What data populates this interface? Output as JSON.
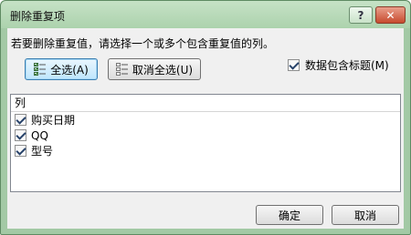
{
  "window": {
    "title": "删除重复项",
    "help_glyph": "?",
    "close_glyph": "✕"
  },
  "prompt": "若要删除重复值，请选择一个或多个包含重复值的列。",
  "toolbar": {
    "select_all_label": "全选(A)",
    "deselect_all_label": "取消全选(U)",
    "select_all_icon": "select-all-icon",
    "deselect_all_icon": "deselect-all-icon"
  },
  "headers_option": {
    "label": "数据包含标题(M)",
    "checked": true
  },
  "list": {
    "header": "列",
    "items": [
      {
        "label": "购买日期",
        "checked": true
      },
      {
        "label": "QQ",
        "checked": true
      },
      {
        "label": "型号",
        "checked": true
      }
    ]
  },
  "footer": {
    "ok_label": "确定",
    "cancel_label": "取消"
  }
}
